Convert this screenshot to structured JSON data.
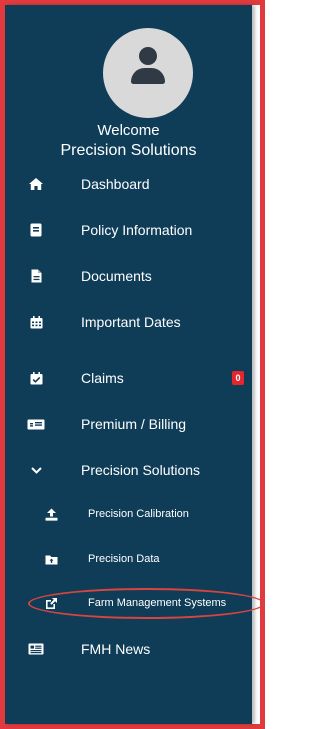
{
  "welcome": {
    "line1": "Welcome",
    "line2": "Precision Solutions"
  },
  "nav": {
    "dashboard": "Dashboard",
    "policy": "Policy Information",
    "documents": "Documents",
    "dates": "Important Dates",
    "claims": "Claims",
    "claims_badge": "0",
    "premium": "Premium / Billing",
    "precision": "Precision Solutions",
    "calibration": "Precision Calibration",
    "data": "Precision Data",
    "farm": "Farm Management Systems",
    "news": "FMH News"
  },
  "colors": {
    "sidebar_bg": "#0f3d58",
    "badge": "#e5272d",
    "frame": "#e03a3e",
    "highlight": "#d8453f"
  },
  "icons": [
    "home-icon",
    "policy-icon",
    "document-icon",
    "calendar-icon",
    "calendar-check-icon",
    "billing-icon",
    "chevron-down-icon",
    "upload-icon",
    "folder-icon",
    "external-link-icon",
    "news-icon"
  ]
}
